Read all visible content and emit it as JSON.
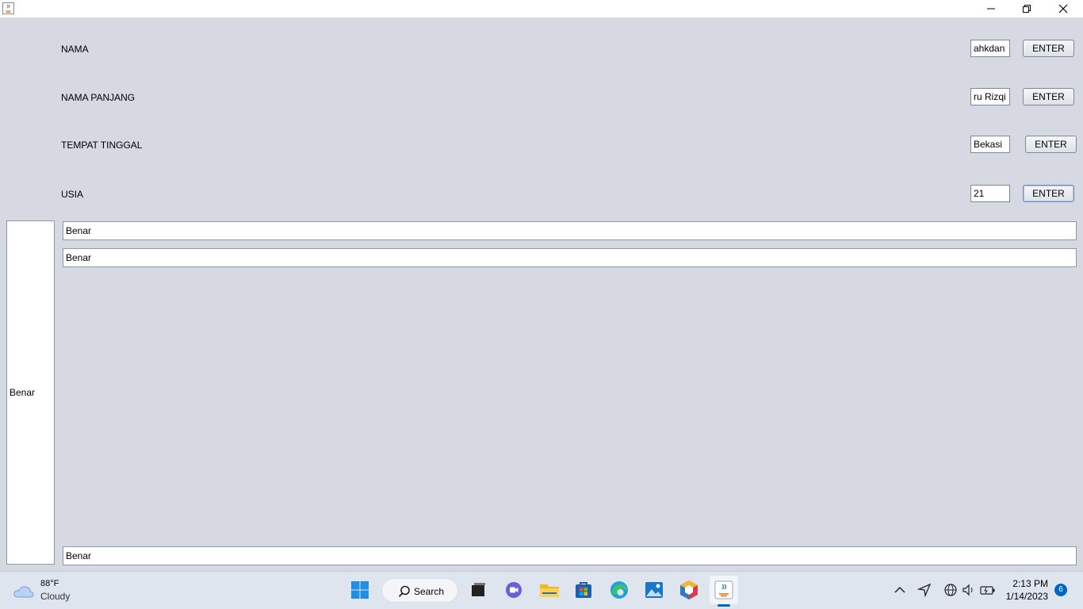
{
  "window": {
    "minimize_glyph": "—",
    "restore_glyph": "❐",
    "close_glyph": "✕"
  },
  "form": {
    "rows": [
      {
        "label": "NAMA",
        "value": "ahkdan",
        "button": "ENTER"
      },
      {
        "label": "NAMA PANJANG",
        "value": "ru Rizqi",
        "button": "ENTER"
      },
      {
        "label": "TEMPAT TINGGAL",
        "value": "Bekasi",
        "button": "ENTER"
      },
      {
        "label": "USIA",
        "value": "21",
        "button": "ENTER"
      }
    ]
  },
  "output": {
    "field1": "Benar",
    "field2": "Benar",
    "side": "Benar",
    "field_bottom": "Benar"
  },
  "taskbar": {
    "weather_temp": "88°F",
    "weather_desc": "Cloudy",
    "search_label": "Search",
    "time": "2:13 PM",
    "date": "1/14/2023",
    "notification_count": "6",
    "colors": {
      "accent": "#0067c0",
      "app_bg": "#d6d9e1"
    }
  }
}
